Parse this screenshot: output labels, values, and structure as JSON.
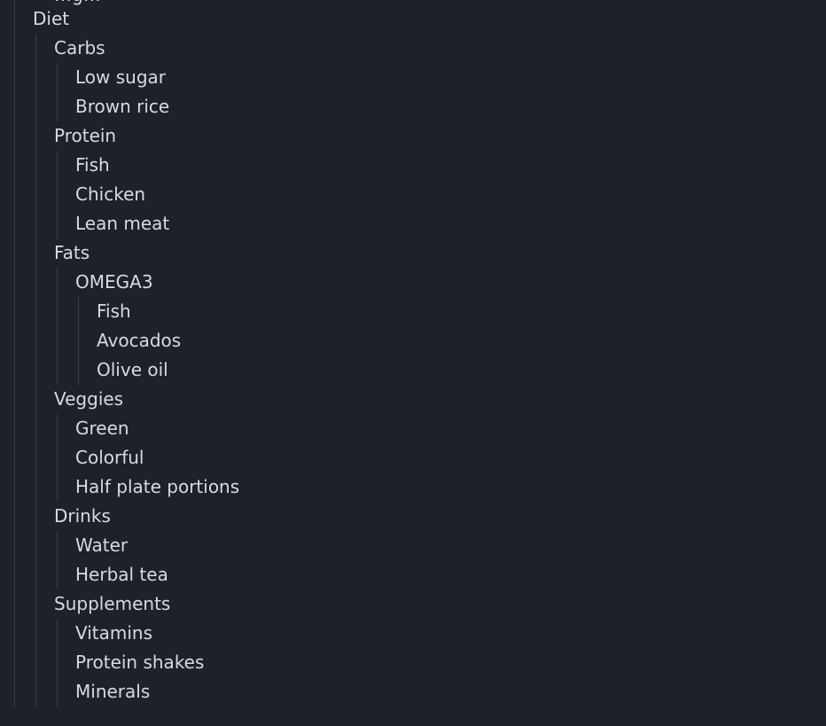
{
  "outline": {
    "top_fragment": "…g…",
    "items": [
      {
        "label": "Diet",
        "depth": 1
      },
      {
        "label": "Carbs",
        "depth": 2
      },
      {
        "label": "Low sugar",
        "depth": 3
      },
      {
        "label": "Brown rice",
        "depth": 3
      },
      {
        "label": "Protein",
        "depth": 2
      },
      {
        "label": "Fish",
        "depth": 3
      },
      {
        "label": "Chicken",
        "depth": 3
      },
      {
        "label": "Lean meat",
        "depth": 3
      },
      {
        "label": "Fats",
        "depth": 2
      },
      {
        "label": "OMEGA3",
        "depth": 3
      },
      {
        "label": "Fish",
        "depth": 4
      },
      {
        "label": "Avocados",
        "depth": 4
      },
      {
        "label": "Olive oil",
        "depth": 4
      },
      {
        "label": "Veggies",
        "depth": 2
      },
      {
        "label": "Green",
        "depth": 3
      },
      {
        "label": "Colorful",
        "depth": 3
      },
      {
        "label": "Half plate portions",
        "depth": 3
      },
      {
        "label": "Drinks",
        "depth": 2
      },
      {
        "label": "Water",
        "depth": 3
      },
      {
        "label": "Herbal tea",
        "depth": 3
      },
      {
        "label": "Supplements",
        "depth": 2
      },
      {
        "label": "Vitamins",
        "depth": 3
      },
      {
        "label": "Protein shakes",
        "depth": 3
      },
      {
        "label": "Minerals",
        "depth": 3
      }
    ]
  },
  "colors": {
    "background": "#1e2228",
    "text": "#d8dadf",
    "guide_line": "#3a3f47"
  }
}
